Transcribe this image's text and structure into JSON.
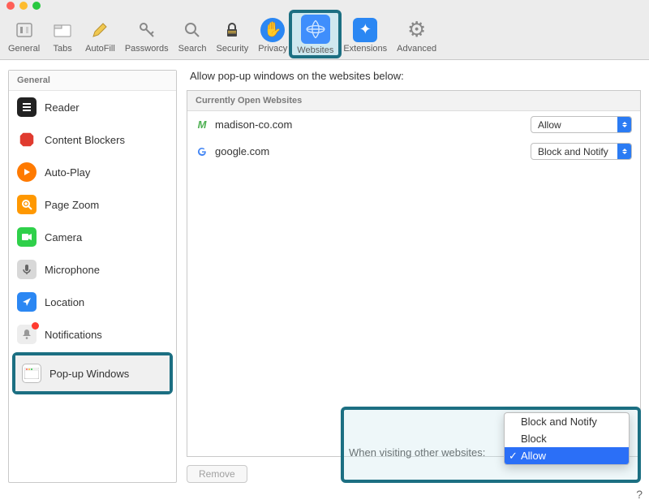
{
  "window": {
    "title": "Websites"
  },
  "toolbar": [
    {
      "id": "general",
      "label": "General"
    },
    {
      "id": "tabs",
      "label": "Tabs"
    },
    {
      "id": "autofill",
      "label": "AutoFill"
    },
    {
      "id": "passwords",
      "label": "Passwords"
    },
    {
      "id": "search",
      "label": "Search"
    },
    {
      "id": "security",
      "label": "Security"
    },
    {
      "id": "privacy",
      "label": "Privacy"
    },
    {
      "id": "websites",
      "label": "Websites",
      "selected": true
    },
    {
      "id": "extensions",
      "label": "Extensions"
    },
    {
      "id": "advanced",
      "label": "Advanced"
    }
  ],
  "sidebar": {
    "header": "General",
    "items": [
      {
        "id": "reader",
        "label": "Reader"
      },
      {
        "id": "content-blockers",
        "label": "Content Blockers"
      },
      {
        "id": "auto-play",
        "label": "Auto-Play"
      },
      {
        "id": "page-zoom",
        "label": "Page Zoom"
      },
      {
        "id": "camera",
        "label": "Camera"
      },
      {
        "id": "microphone",
        "label": "Microphone"
      },
      {
        "id": "location",
        "label": "Location"
      },
      {
        "id": "notifications",
        "label": "Notifications"
      },
      {
        "id": "popup-windows",
        "label": "Pop-up Windows",
        "selected": true
      }
    ]
  },
  "content": {
    "title": "Allow pop-up windows on the websites below:",
    "list_header": "Currently Open Websites",
    "sites": [
      {
        "domain": "madison-co.com",
        "favicon": "M",
        "setting": "Allow"
      },
      {
        "domain": "google.com",
        "favicon": "G",
        "setting": "Block and Notify"
      }
    ],
    "remove_label": "Remove",
    "other_label": "When visiting other websites:",
    "dropdown": {
      "options": [
        "Block and Notify",
        "Block",
        "Allow"
      ],
      "selected": "Allow"
    }
  },
  "help": "?"
}
